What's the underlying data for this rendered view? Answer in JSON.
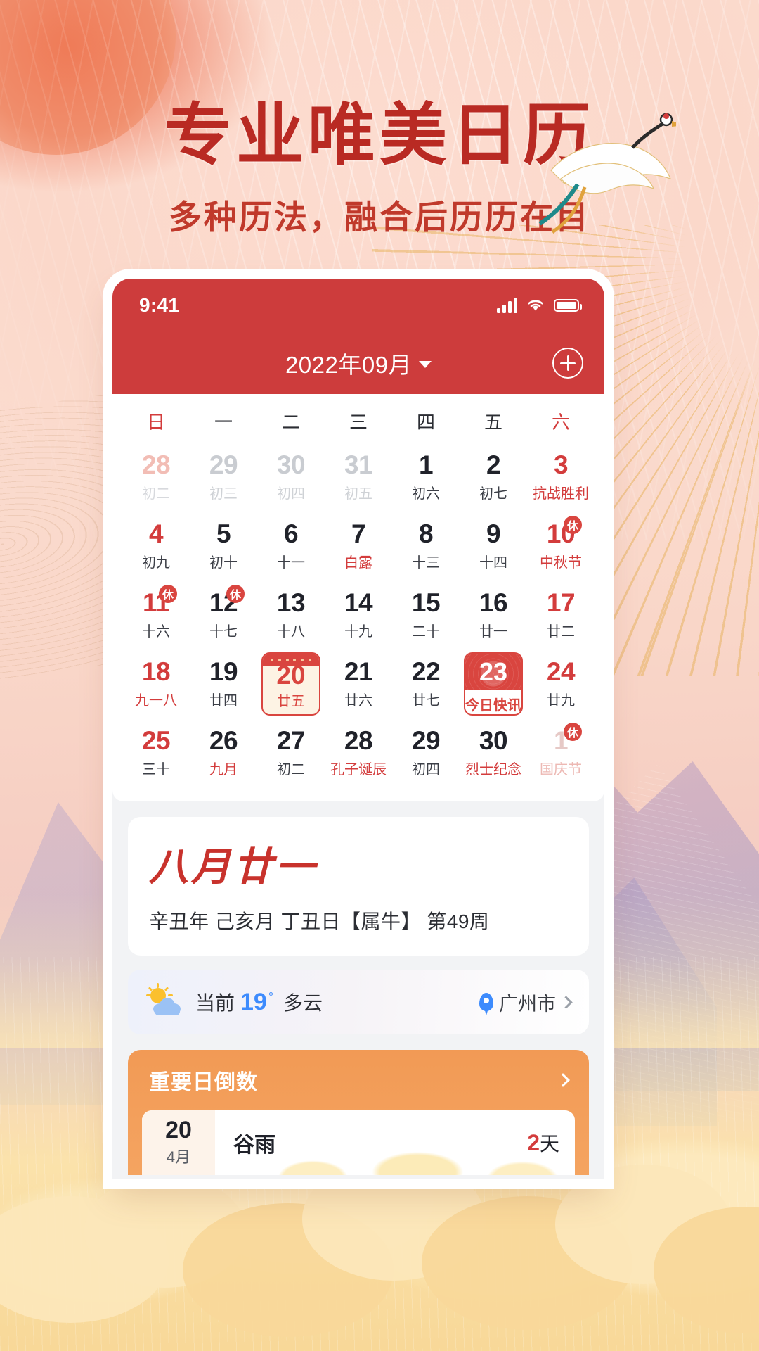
{
  "poster": {
    "headline": "专业唯美日历",
    "subhead": "多种历法，融合后历历在目"
  },
  "statusbar": {
    "time": "9:41",
    "signal_icon": "signal-bars-icon",
    "wifi_icon": "wifi-icon",
    "battery_icon": "battery-icon"
  },
  "navbar": {
    "title": "2022年09月",
    "caret_icon": "chevron-down-icon",
    "add_icon": "plus-circle-icon"
  },
  "calendar": {
    "weekdays": [
      "日",
      "一",
      "二",
      "三",
      "四",
      "五",
      "六"
    ],
    "rows": [
      [
        {
          "d": "28",
          "l": "初二",
          "state": "out-sun"
        },
        {
          "d": "29",
          "l": "初三",
          "state": "out"
        },
        {
          "d": "30",
          "l": "初四",
          "state": "out"
        },
        {
          "d": "31",
          "l": "初五",
          "state": "out"
        },
        {
          "d": "1",
          "l": "初六",
          "state": "normal"
        },
        {
          "d": "2",
          "l": "初七",
          "state": "normal"
        },
        {
          "d": "3",
          "l": "抗战胜利",
          "state": "red"
        }
      ],
      [
        {
          "d": "4",
          "l": "初九",
          "state": "red-num"
        },
        {
          "d": "5",
          "l": "初十",
          "state": "normal"
        },
        {
          "d": "6",
          "l": "十一",
          "state": "normal"
        },
        {
          "d": "7",
          "l": "白露",
          "state": "red-sub"
        },
        {
          "d": "8",
          "l": "十三",
          "state": "normal"
        },
        {
          "d": "9",
          "l": "十四",
          "state": "normal"
        },
        {
          "d": "10",
          "l": "中秋节",
          "state": "red",
          "badge": "休"
        }
      ],
      [
        {
          "d": "11",
          "l": "十六",
          "state": "red-num",
          "badge": "休"
        },
        {
          "d": "12",
          "l": "十七",
          "state": "normal",
          "badge": "休"
        },
        {
          "d": "13",
          "l": "十八",
          "state": "normal"
        },
        {
          "d": "14",
          "l": "十九",
          "state": "normal"
        },
        {
          "d": "15",
          "l": "二十",
          "state": "normal"
        },
        {
          "d": "16",
          "l": "廿一",
          "state": "normal"
        },
        {
          "d": "17",
          "l": "廿二",
          "state": "red-num"
        }
      ],
      [
        {
          "d": "18",
          "l": "九一八",
          "state": "red"
        },
        {
          "d": "19",
          "l": "廿四",
          "state": "normal"
        },
        {
          "d": "20",
          "l": "廿五",
          "state": "selected"
        },
        {
          "d": "21",
          "l": "廿六",
          "state": "normal"
        },
        {
          "d": "22",
          "l": "廿七",
          "state": "normal"
        },
        {
          "d": "23",
          "l": "今日快讯",
          "state": "today"
        },
        {
          "d": "24",
          "l": "廿九",
          "state": "red-num"
        }
      ],
      [
        {
          "d": "25",
          "l": "三十",
          "state": "red-num"
        },
        {
          "d": "26",
          "l": "九月",
          "state": "red-sub"
        },
        {
          "d": "27",
          "l": "初二",
          "state": "normal"
        },
        {
          "d": "28",
          "l": "孔子诞辰",
          "state": "red-sub"
        },
        {
          "d": "29",
          "l": "初四",
          "state": "normal"
        },
        {
          "d": "30",
          "l": "烈士纪念",
          "state": "red-sub"
        },
        {
          "d": "1",
          "l": "国庆节",
          "state": "out-red",
          "badge": "休"
        }
      ]
    ]
  },
  "lunar": {
    "big": "八月廿一",
    "detail": "辛丑年 己亥月 丁丑日【属牛】 第49周"
  },
  "weather": {
    "icon": "sun-cloud-icon",
    "label": "当前",
    "temp": "19",
    "degree": "°",
    "condition": "多云",
    "location_icon": "location-pin-icon",
    "location": "广州市",
    "chevron_icon": "chevron-right-icon"
  },
  "countdown": {
    "title": "重要日倒数",
    "chevron_icon": "chevron-right-icon",
    "items": [
      {
        "day": "20",
        "month": "4月",
        "name": "谷雨",
        "days_num": "2",
        "days_unit": "天"
      }
    ]
  },
  "colors": {
    "brand_red": "#cd3c3c",
    "accent_red": "#d9453f",
    "headline_red": "#b92a23",
    "weather_blue": "#3d8bfd",
    "countdown_orange": "#f29a55"
  }
}
